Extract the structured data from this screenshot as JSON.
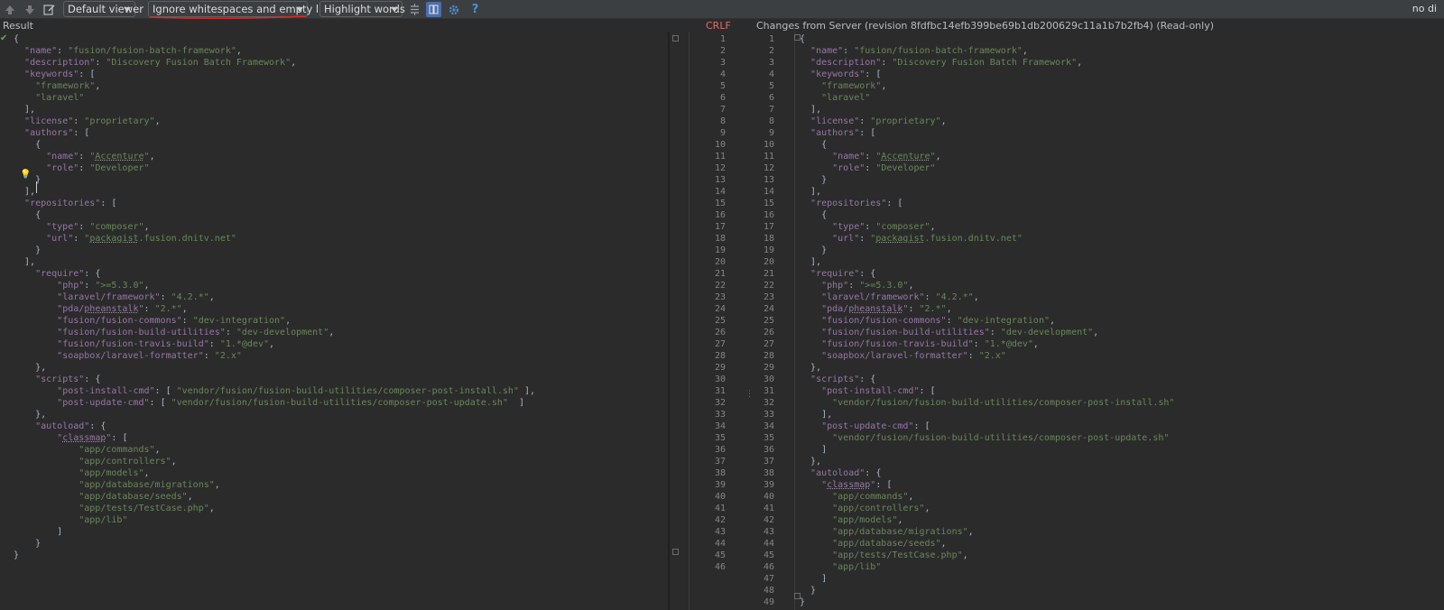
{
  "toolbar": {
    "viewer_label": "Default viewer",
    "whitespace_label": "Ignore whitespaces and empty lines",
    "highlight_label": "Highlight words",
    "status_right": "no di",
    "help_label": "?"
  },
  "header": {
    "result_label": "Result",
    "line_ending": "CRLF",
    "revision_label": "Changes from Server (revision 8fdfbc14efb399be69b1db200629c11a1b7b2fb4) (Read-only)"
  },
  "colors": {
    "accent_red": "#e06c6c",
    "key": "#9876aa",
    "string": "#6a8759",
    "background": "#2b2b2b"
  },
  "left_lines": [
    "{",
    "  \"name\": \"fusion/fusion-batch-framework\",",
    "  \"description\": \"Discovery Fusion Batch Framework\",",
    "  \"keywords\": [",
    "    \"framework\",",
    "    \"laravel\"",
    "  ],",
    "  \"license\": \"proprietary\",",
    "  \"authors\": [",
    "    {",
    "      \"name\": \"Accenture\",",
    "      \"role\": \"Developer\"",
    "    }",
    "  ],",
    "  \"repositories\": [",
    "    {",
    "      \"type\": \"composer\",",
    "      \"url\": \"packagist.fusion.dnitv.net\"",
    "    }",
    "  ],",
    "    \"require\": {",
    "        \"php\": \">=5.3.0\",",
    "        \"laravel/framework\": \"4.2.*\",",
    "        \"pda/pheanstalk\": \"2.*\",",
    "        \"fusion/fusion-commons\": \"dev-integration\",",
    "        \"fusion/fusion-build-utilities\": \"dev-development\",",
    "        \"fusion/fusion-travis-build\": \"1.*@dev\",",
    "        \"soapbox/laravel-formatter\": \"2.x\"",
    "    },",
    "    \"scripts\": {",
    "        \"post-install-cmd\": [ \"vendor/fusion/fusion-build-utilities/composer-post-install.sh\" ],",
    "        \"post-update-cmd\": [ \"vendor/fusion/fusion-build-utilities/composer-post-update.sh\"  ]",
    "    },",
    "    \"autoload\": {",
    "        \"classmap\": [",
    "            \"app/commands\",",
    "            \"app/controllers\",",
    "            \"app/models\",",
    "            \"app/database/migrations\",",
    "            \"app/database/seeds\",",
    "            \"app/tests/TestCase.php\",",
    "            \"app/lib\"",
    "        ]",
    "    }",
    "}"
  ],
  "left_numbers": [
    "1",
    "2",
    "3",
    "4",
    "5",
    "6",
    "7",
    "8",
    "9",
    "10",
    "11",
    "12",
    "13",
    "14",
    "15",
    "16",
    "17",
    "18",
    "19",
    "20",
    "21",
    "22",
    "23",
    "24",
    "25",
    "26",
    "27",
    "28",
    "29",
    "30",
    "31",
    "32",
    "33",
    "34",
    "35",
    "36",
    "37",
    "38",
    "39",
    "40",
    "41",
    "42",
    "43",
    "44",
    "45",
    "46"
  ],
  "right_numbers": [
    "1",
    "2",
    "3",
    "4",
    "5",
    "6",
    "7",
    "8",
    "9",
    "10",
    "11",
    "12",
    "13",
    "14",
    "15",
    "16",
    "17",
    "18",
    "19",
    "20",
    "21",
    "22",
    "23",
    "24",
    "25",
    "26",
    "27",
    "28",
    "29",
    "30",
    "31",
    "32",
    "33",
    "34",
    "35",
    "36",
    "37",
    "38",
    "39",
    "40",
    "41",
    "42",
    "43",
    "44",
    "45",
    "46",
    "47",
    "48",
    "49"
  ],
  "right_lines": [
    "{",
    "  \"name\": \"fusion/fusion-batch-framework\",",
    "  \"description\": \"Discovery Fusion Batch Framework\",",
    "  \"keywords\": [",
    "    \"framework\",",
    "    \"laravel\"",
    "  ],",
    "  \"license\": \"proprietary\",",
    "  \"authors\": [",
    "    {",
    "      \"name\": \"Accenture\",",
    "      \"role\": \"Developer\"",
    "    }",
    "  ],",
    "  \"repositories\": [",
    "    {",
    "      \"type\": \"composer\",",
    "      \"url\": \"packagist.fusion.dnitv.net\"",
    "    }",
    "  ],",
    "  \"require\": {",
    "    \"php\": \">=5.3.0\",",
    "    \"laravel/framework\": \"4.2.*\",",
    "    \"pda/pheanstalk\": \"2.*\",",
    "    \"fusion/fusion-commons\": \"dev-integration\",",
    "    \"fusion/fusion-build-utilities\": \"dev-development\",",
    "    \"fusion/fusion-travis-build\": \"1.*@dev\",",
    "    \"soapbox/laravel-formatter\": \"2.x\"",
    "  },",
    "  \"scripts\": {",
    "    \"post-install-cmd\": [",
    "      \"vendor/fusion/fusion-build-utilities/composer-post-install.sh\"",
    "    ],",
    "    \"post-update-cmd\": [",
    "      \"vendor/fusion/fusion-build-utilities/composer-post-update.sh\"",
    "    ]",
    "  },",
    "  \"autoload\": {",
    "    \"classmap\": [",
    "      \"app/commands\",",
    "      \"app/controllers\",",
    "      \"app/models\",",
    "      \"app/database/migrations\",",
    "      \"app/database/seeds\",",
    "      \"app/tests/TestCase.php\",",
    "      \"app/lib\"",
    "    ]",
    "  }",
    "}"
  ]
}
